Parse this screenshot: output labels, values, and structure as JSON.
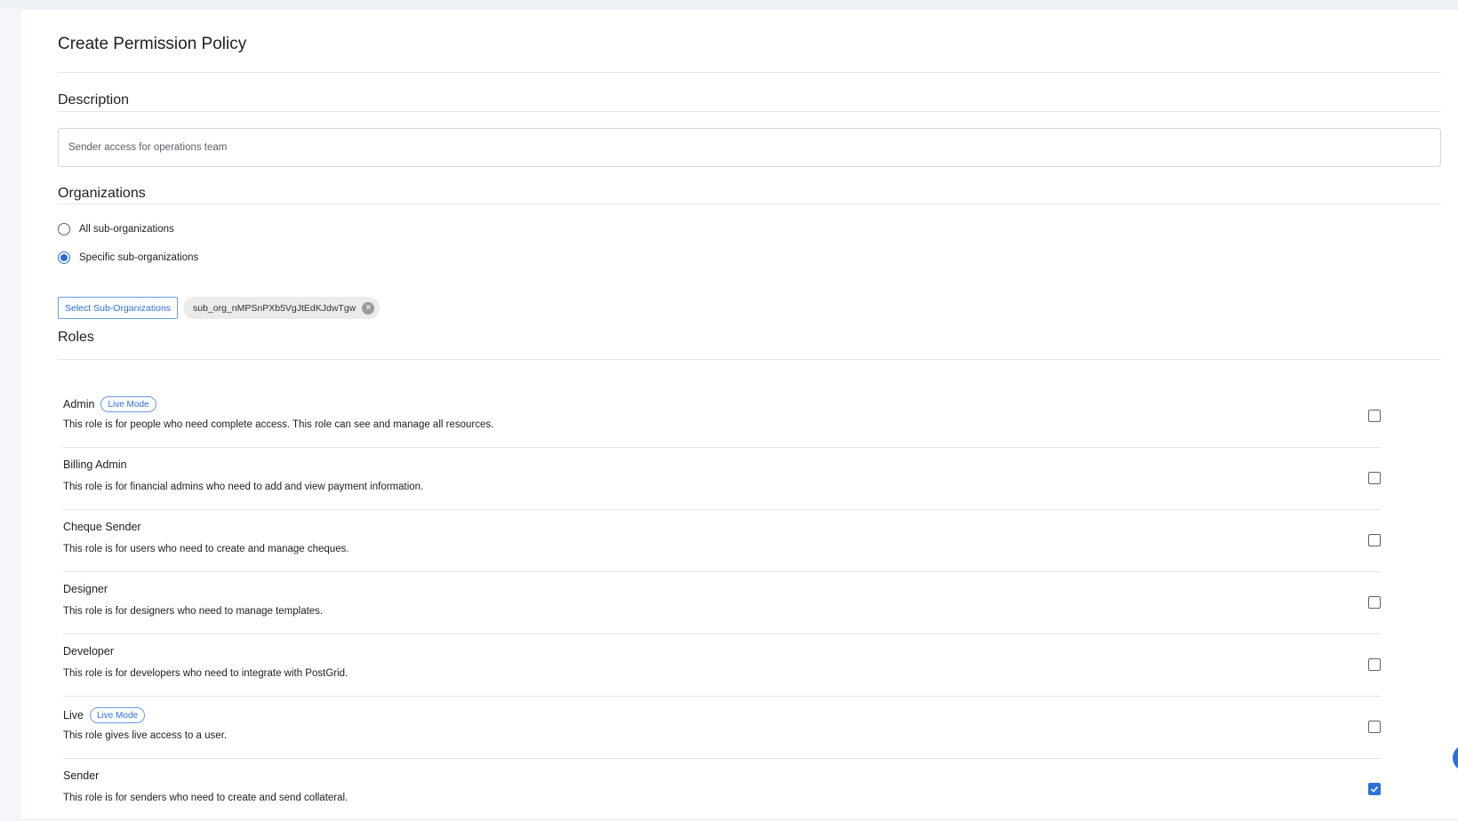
{
  "page": {
    "title": "Create Permission Policy"
  },
  "description": {
    "heading": "Description",
    "value": "Sender access for operations team"
  },
  "organizations": {
    "heading": "Organizations",
    "options": [
      {
        "label": "All sub-organizations",
        "selected": false
      },
      {
        "label": "Specific sub-organizations",
        "selected": true
      }
    ],
    "select_button_label": "Select Sub-Organizations",
    "selected_chips": [
      "sub_org_nMPSnPXb5VgJtEdKJdwTgw"
    ]
  },
  "roles": {
    "heading": "Roles",
    "items": [
      {
        "name": "Admin",
        "badge": "Live Mode",
        "description": "This role is for people who need complete access. This role can see and manage all resources.",
        "checked": false
      },
      {
        "name": "Billing Admin",
        "badge": "",
        "description": "This role is for financial admins who need to add and view payment information.",
        "checked": false
      },
      {
        "name": "Cheque Sender",
        "badge": "",
        "description": "This role is for users who need to create and manage cheques.",
        "checked": false
      },
      {
        "name": "Designer",
        "badge": "",
        "description": "This role is for designers who need to manage templates.",
        "checked": false
      },
      {
        "name": "Developer",
        "badge": "",
        "description": "This role is for developers who need to integrate with PostGrid.",
        "checked": false
      },
      {
        "name": "Live",
        "badge": "Live Mode",
        "description": "This role gives live access to a user.",
        "checked": false
      },
      {
        "name": "Sender",
        "badge": "",
        "description": "This role is for senders who need to create and send collateral.",
        "checked": true
      }
    ]
  },
  "colors": {
    "accent": "#2e6fd8",
    "divider": "#e3e5e8",
    "background": "#f4f6fa"
  }
}
